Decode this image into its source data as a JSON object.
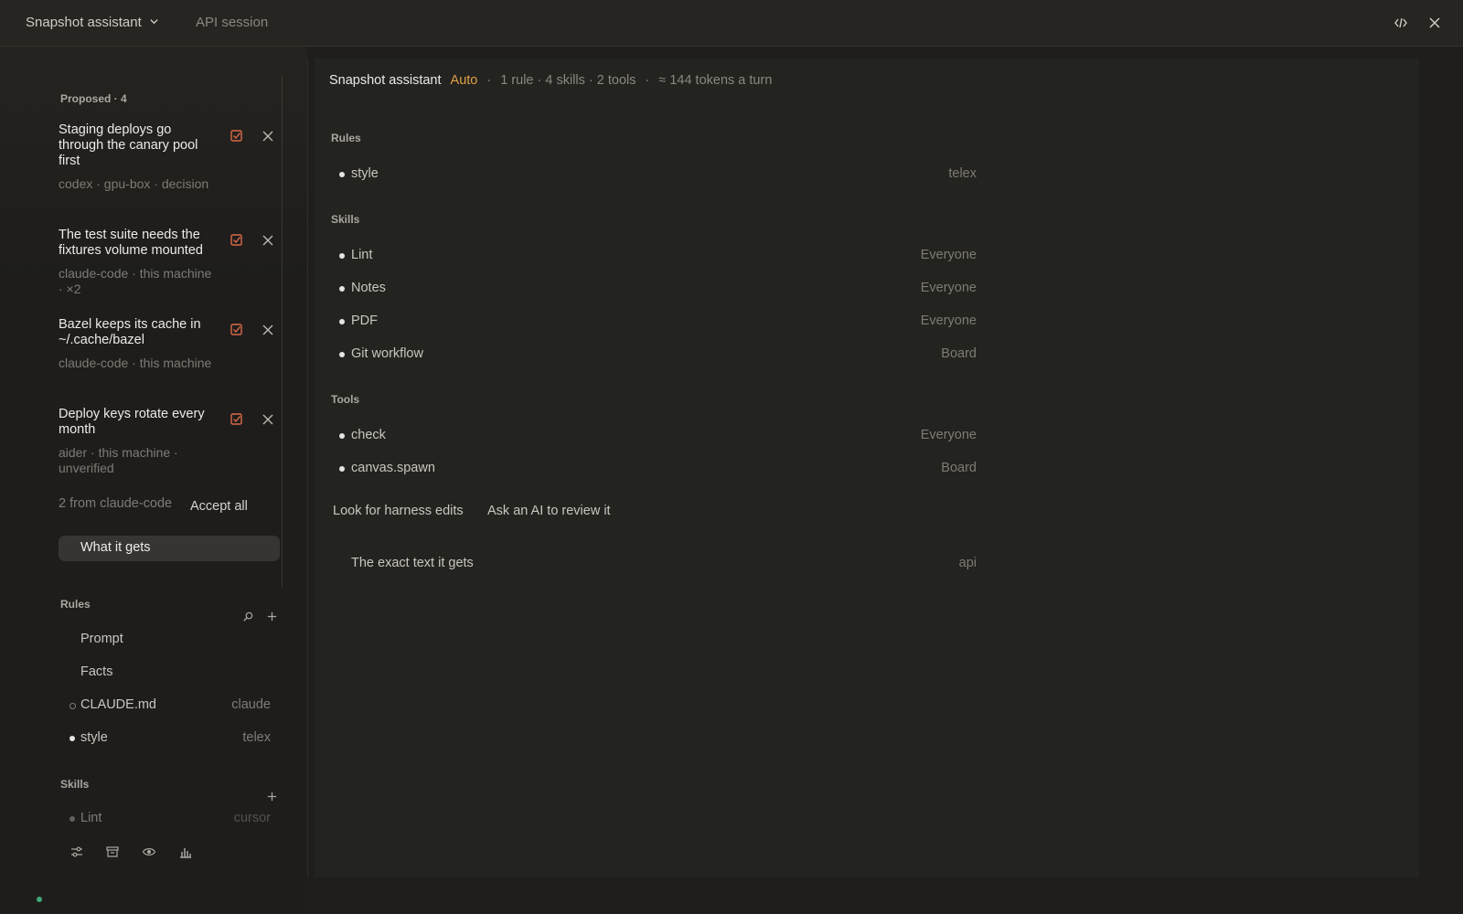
{
  "topbar": {
    "app_name": "Snapshot assistant",
    "session_label": "API session"
  },
  "proposed": {
    "title": "Proposed · 4",
    "items": [
      {
        "title": "Staging deploys go through the canary pool first",
        "meta": "codex · gpu-box · decision"
      },
      {
        "title": "The test suite needs the fixtures volume mounted",
        "meta": "claude-code · this machine · ×2"
      },
      {
        "title": "Bazel keeps its cache in ~/.cache/bazel",
        "meta": "claude-code · this machine"
      },
      {
        "title": "Deploy keys rotate every month",
        "meta": "aider · this machine · unverified"
      }
    ],
    "from_text": "2 from claude-code",
    "accept_all": "Accept all",
    "what_it_gets": "What it gets"
  },
  "sidebar": {
    "rules_title": "Rules",
    "rules": [
      {
        "label": "Prompt",
        "value": ""
      },
      {
        "label": "Facts",
        "value": ""
      },
      {
        "label": "CLAUDE.md",
        "value": "claude"
      },
      {
        "label": "style",
        "value": "telex"
      }
    ],
    "skills_title": "Skills",
    "skills": [
      {
        "label": "Lint",
        "value": "cursor"
      }
    ]
  },
  "main": {
    "name": "Snapshot assistant",
    "mode": "Auto",
    "sep": "·",
    "summary": "1 rule · 4 skills · 2 tools",
    "tokens": "≈ 144 tokens a turn",
    "rules_title": "Rules",
    "rules": [
      {
        "label": "style",
        "value": "telex"
      }
    ],
    "skills_title": "Skills",
    "skills": [
      {
        "label": "Lint",
        "value": "Everyone"
      },
      {
        "label": "Notes",
        "value": "Everyone"
      },
      {
        "label": "PDF",
        "value": "Everyone"
      },
      {
        "label": "Git workflow",
        "value": "Board"
      }
    ],
    "tools_title": "Tools",
    "tools": [
      {
        "label": "check",
        "value": "Everyone"
      },
      {
        "label": "canvas.spawn",
        "value": "Board"
      }
    ],
    "harness_link": "Look for harness edits",
    "review_link": "Ask an AI to review it",
    "exact_text": {
      "label": "The exact text it gets",
      "value": "api"
    }
  },
  "colors": {
    "accent": "#e0a048",
    "accept_icon": "#d9694a",
    "status": "#3fa878"
  }
}
